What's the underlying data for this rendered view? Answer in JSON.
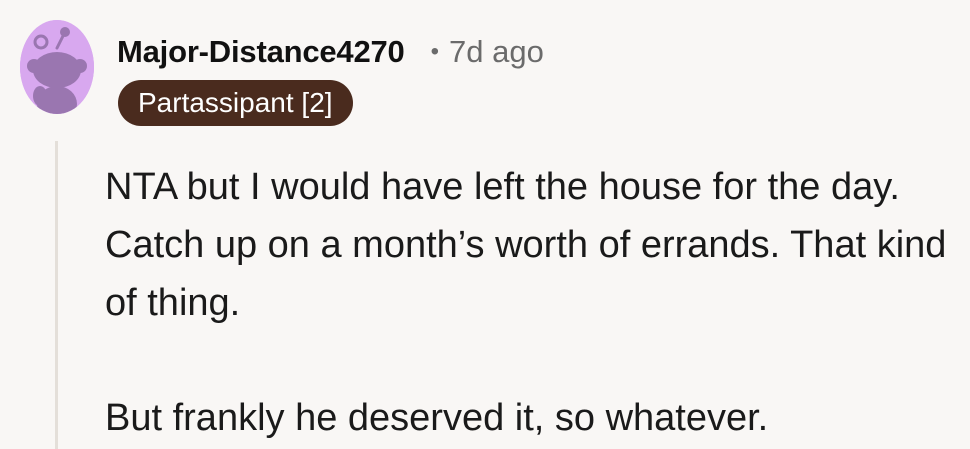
{
  "comment": {
    "username": "Major-Distance4270",
    "separator": "•",
    "timestamp": "7d ago",
    "flair": "Partassipant [2]",
    "paragraphs": [
      "NTA but I would have left the house for the day. Catch up on a month’s worth of errands. That kind of thing.",
      "But frankly he deserved it, so whatever."
    ]
  },
  "colors": {
    "background": "#f9f7f5",
    "avatar_bg": "#d8a8ef",
    "avatar_figure": "#9a76b0",
    "flair_bg": "#4a2b1e",
    "flair_text": "#ffffff",
    "thread_line": "#e4dfd9"
  },
  "icons": {
    "avatar": "snoo-avatar-icon"
  }
}
